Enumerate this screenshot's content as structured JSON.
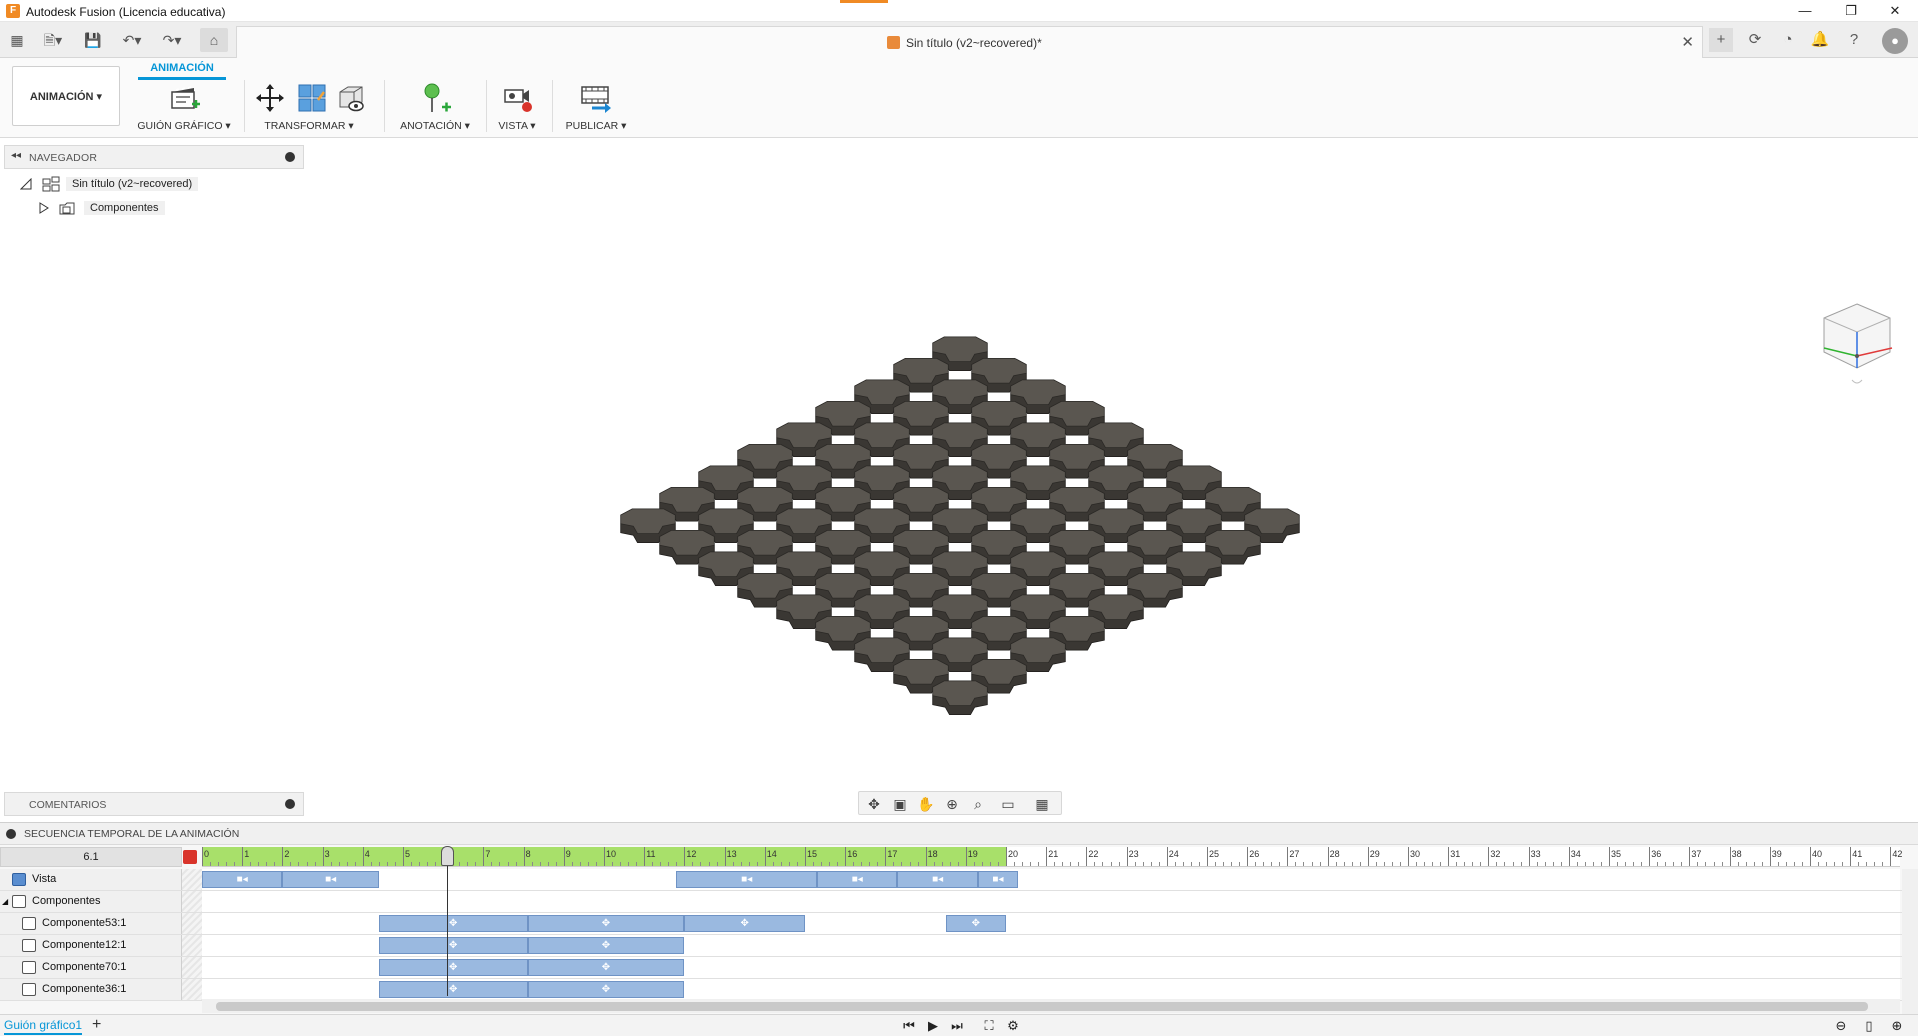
{
  "window": {
    "title": "Autodesk Fusion (Licencia educativa)",
    "minimize": "—",
    "restore": "❐",
    "close": "✕"
  },
  "document": {
    "tab_title": "Sin título (v2~recovered)*",
    "close": "✕"
  },
  "toolbar": {
    "workspace_label": "ANIMACIÓN ▾",
    "active_tab": "ANIMACIÓN",
    "groups": [
      {
        "label": "GUIÓN GRÁFICO ▾"
      },
      {
        "label": "TRANSFORMAR ▾"
      },
      {
        "label": "ANOTACIÓN ▾"
      },
      {
        "label": "VISTA ▾"
      },
      {
        "label": "PUBLICAR ▾"
      }
    ]
  },
  "navigator": {
    "title": "NAVEGADOR",
    "root_label": "Sin título (v2~recovered)",
    "child_label": "Componentes"
  },
  "comments": {
    "title": "COMENTARIOS"
  },
  "timeline": {
    "title": "SECUENCIA TEMPORAL DE LA ANIMACIÓN",
    "current_time": "6.1",
    "ruler_start": 0,
    "ruler_end": 42,
    "active_end": 20,
    "playhead_time": 6.1,
    "rows": [
      {
        "label": "Vista",
        "kind": "view",
        "clips": [
          [
            0,
            2
          ],
          [
            2,
            4.4
          ],
          [
            11.8,
            15.3
          ],
          [
            15.3,
            17.3
          ],
          [
            17.3,
            19.3
          ],
          [
            19.3,
            20.3
          ]
        ]
      },
      {
        "label": "Componentes",
        "kind": "group",
        "clips": []
      },
      {
        "label": "Componente53:1",
        "kind": "component",
        "clips": [
          [
            4.4,
            8.1
          ],
          [
            8.1,
            12
          ],
          [
            12,
            15
          ],
          [
            18.5,
            20
          ]
        ]
      },
      {
        "label": "Componente12:1",
        "kind": "component",
        "clips": [
          [
            4.4,
            8.1
          ],
          [
            8.1,
            12
          ]
        ]
      },
      {
        "label": "Componente70:1",
        "kind": "component",
        "clips": [
          [
            4.4,
            8.1
          ],
          [
            8.1,
            12
          ]
        ]
      },
      {
        "label": "Componente36:1",
        "kind": "component",
        "clips": [
          [
            4.4,
            8.1
          ],
          [
            8.1,
            12
          ]
        ]
      }
    ]
  },
  "bottom": {
    "storyboard_tab": "Guión gráfico1",
    "add": "+"
  },
  "colors": {
    "accent": "#0696d7",
    "tile_top": "#5a5650",
    "tile_side": "#3a3733",
    "timeline_active": "#a8e06a",
    "clip": "#9ab9e0"
  },
  "icons": {
    "app": "fusion-logo-icon",
    "home": "home-icon",
    "grid": "app-grid-icon",
    "save": "save-icon"
  }
}
